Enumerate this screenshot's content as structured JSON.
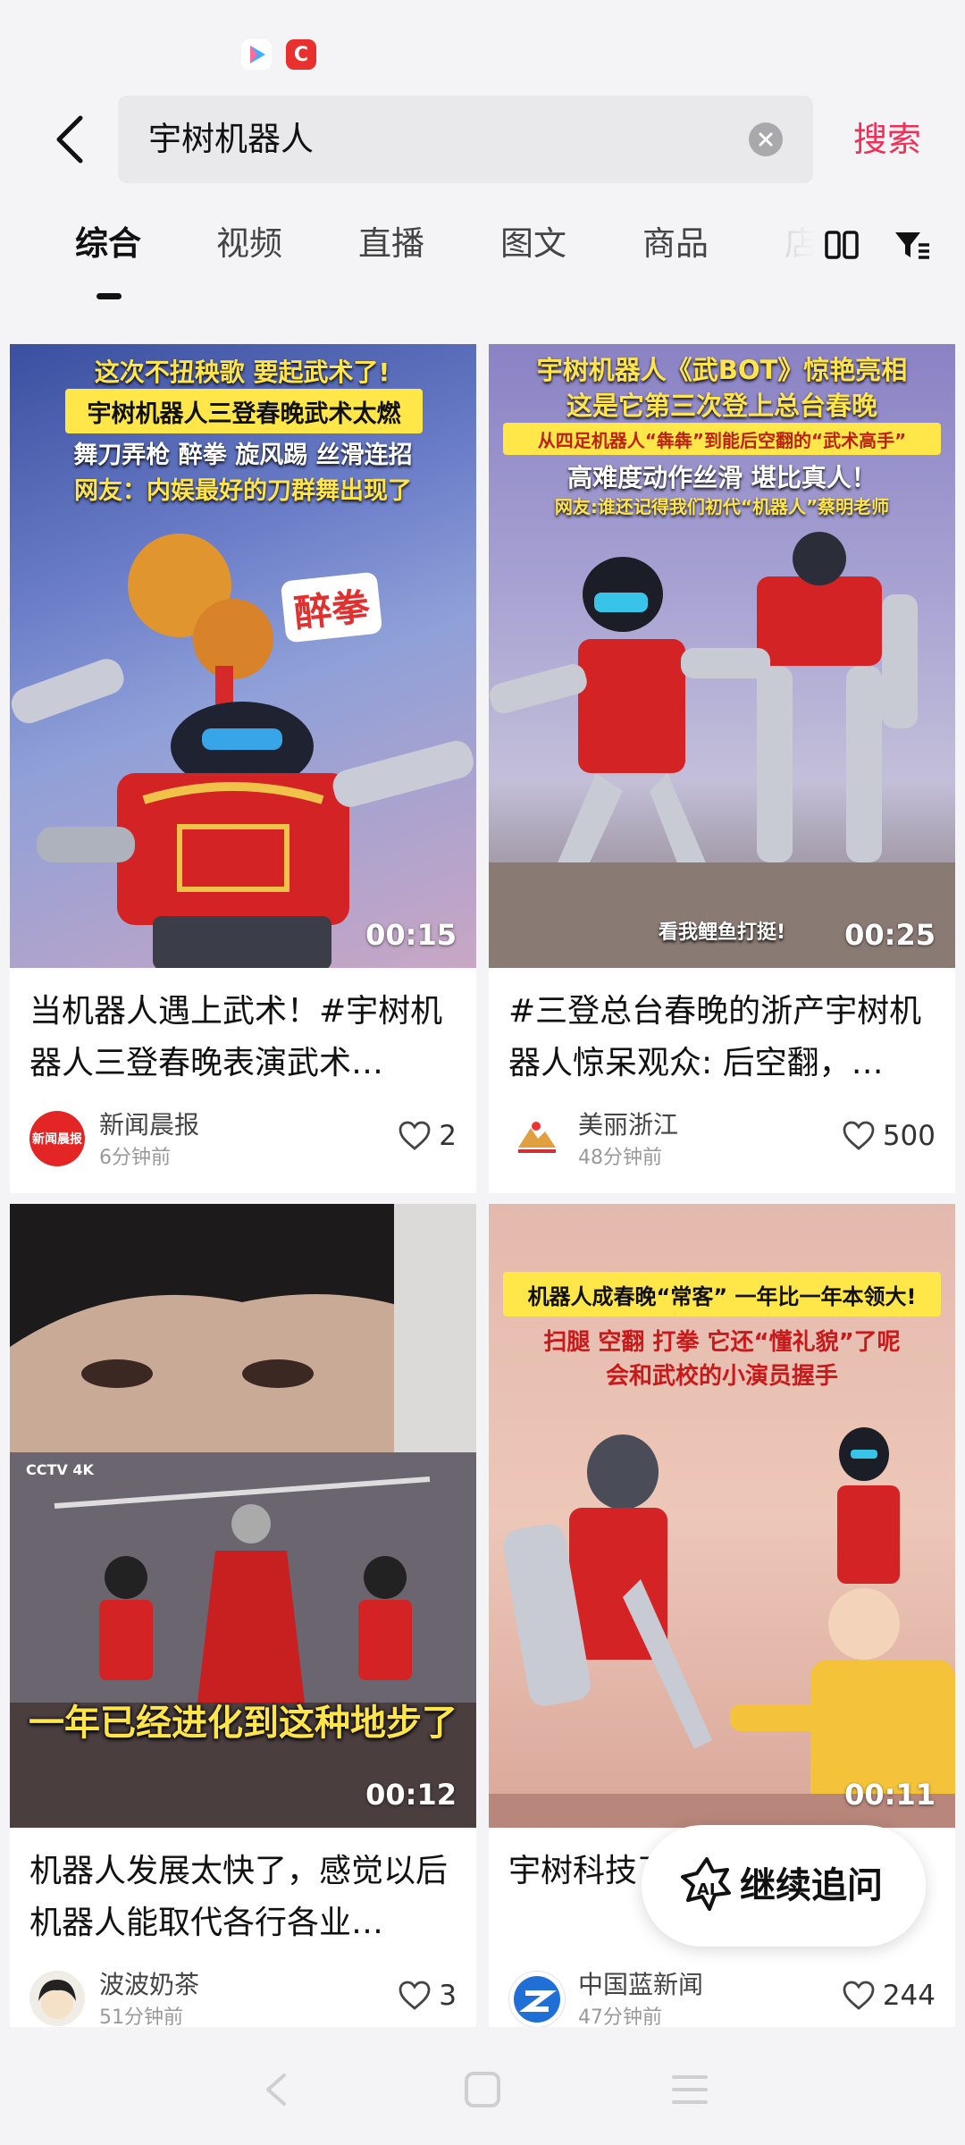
{
  "status_bar": {
    "icons": [
      "video-app-icon",
      "c-app-icon"
    ],
    "c_icon_letter": "C"
  },
  "header": {
    "search_query": "宇树机器人",
    "search_button_label": "搜索"
  },
  "tabs": [
    {
      "label": "综合",
      "active": true
    },
    {
      "label": "视频",
      "active": false
    },
    {
      "label": "直播",
      "active": false
    },
    {
      "label": "图文",
      "active": false
    },
    {
      "label": "商品",
      "active": false
    },
    {
      "label": "店",
      "active": false
    }
  ],
  "results": [
    {
      "overlay": [
        "这次不扭秧歌 要起武术了!",
        "宇树机器人三登春晚武术太燃",
        "舞刀弄枪 醉拳 旋风踢 丝滑连招",
        "网友：内娱最好的刀群舞出现了"
      ],
      "sticker": "醉拳",
      "duration": "00:15",
      "title": "当机器人遇上武术！#宇树机器人三登春晚表演武术…",
      "author": "新闻晨报",
      "time": "6分钟前",
      "likes": "2"
    },
    {
      "overlay": [
        "宇树机器人《武BOT》惊艳亮相",
        "这是它第三次登上总台春晚",
        "从四足机器人“犇犇”到能后空翻的“武术高手”",
        "高难度动作丝滑 堪比真人！",
        "网友:谁还记得我们初代“机器人”蔡明老师"
      ],
      "subtitle": "看我鲤鱼打挺!",
      "duration": "00:25",
      "title": "#三登总台春晚的浙产宇树机器人惊呆观众: 后空翻，…",
      "author": "美丽浙江",
      "time": "48分钟前",
      "likes": "500"
    },
    {
      "overlay": [
        "一年已经进化到这种地步了"
      ],
      "watermark": "CCTV 4K",
      "duration": "00:12",
      "title": "机器人发展太快了，感觉以后机器人能取代各行各业…",
      "author": "波波奶茶",
      "time": "51分钟前",
      "likes": "3"
    },
    {
      "overlay": [
        "机器人成春晚“常客” 一年比一年本领大!",
        "扫腿 空翻 打拳 它还“懂礼貌”了呢",
        "会和武校的小演员握手"
      ],
      "duration": "00:11",
      "title": "宇树科技了！与河",
      "author": "中国蓝新闻",
      "time": "47分钟前",
      "likes": "244"
    }
  ],
  "floating_button": {
    "label": "继续追问",
    "icon": "ai-icon",
    "icon_text": "AI"
  },
  "colors": {
    "accent": "#ef2f57",
    "background": "#f4f4f6"
  }
}
